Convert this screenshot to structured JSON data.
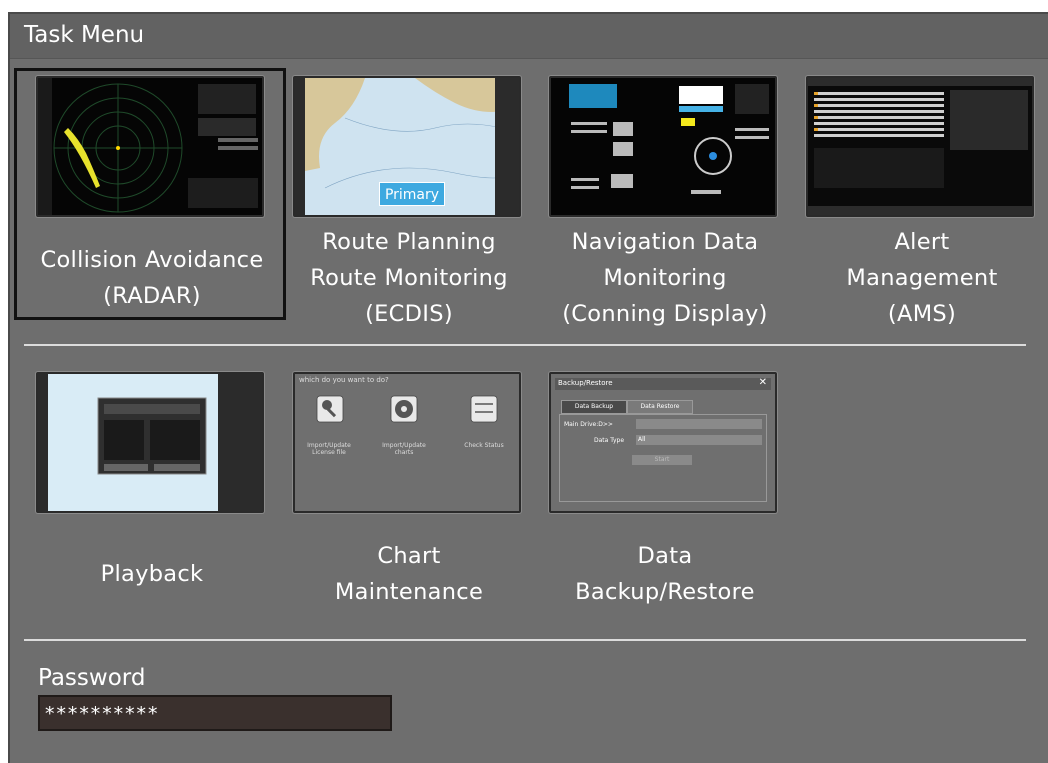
{
  "window": {
    "title": "Task Menu"
  },
  "tasks_row1": [
    {
      "name": "radar",
      "label": "Collision Avoidance\n(RADAR)",
      "selected": true
    },
    {
      "name": "ecdis",
      "label": "Route Planning\nRoute Monitoring\n(ECDIS)",
      "thumb_badge": "Primary"
    },
    {
      "name": "conning",
      "label": "Navigation Data\nMonitoring\n(Conning Display)"
    },
    {
      "name": "ams",
      "label": "Alert\nManagement\n(AMS)"
    }
  ],
  "tasks_row2": [
    {
      "name": "playback",
      "label": "Playback"
    },
    {
      "name": "chart-maintenance",
      "label": "Chart\nMaintenance",
      "thumb": {
        "prompt": "which do you want to do?",
        "items": [
          "Import/Update License file",
          "Import/Update charts",
          "Check Status"
        ]
      }
    },
    {
      "name": "backup",
      "label": "Data\nBackup/Restore",
      "thumb": {
        "title": "Backup/Restore",
        "tabs": [
          "Data Backup",
          "Data Restore"
        ],
        "fields": [
          {
            "label": "Main Drive:D>>",
            "value": ""
          },
          {
            "label": "Data Type",
            "value": "All"
          }
        ],
        "button": "Start"
      }
    }
  ],
  "password": {
    "label": "Password",
    "value": "**********"
  },
  "colors": {
    "background": "#6e6e6e",
    "titlebar": "#626262",
    "divider": "#dcdcdc",
    "field": "#3a302d"
  }
}
